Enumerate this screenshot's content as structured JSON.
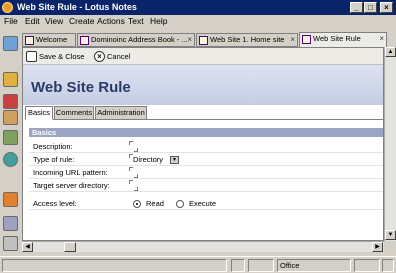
{
  "window": {
    "title": "Web Site Rule - Lotus Notes",
    "minimize": "_",
    "maximize": "□",
    "close": "×"
  },
  "menu": [
    "File",
    "Edit",
    "View",
    "Create",
    "Actions",
    "Text",
    "Help"
  ],
  "tabs": [
    {
      "label": "Welcome"
    },
    {
      "label": "Dominoinc Address Book - ..."
    },
    {
      "label": "Web Site 1. Home site"
    },
    {
      "label": "Web Site Rule"
    }
  ],
  "tab_close": "×",
  "actions": {
    "save_close": "Save & Close",
    "cancel": "Cancel"
  },
  "form": {
    "title": "Web Site Rule",
    "subtabs": [
      "Basics",
      "Comments",
      "Administration"
    ],
    "section": "Basics",
    "fields": {
      "description": "Description:",
      "type": "Type of rule:",
      "type_value": "Directory",
      "incoming": "Incoming URL pattern:",
      "target": "Target server directory:",
      "access": "Access level:"
    },
    "access_options": [
      "Read",
      "Execute"
    ],
    "access_selected": "Read"
  },
  "status": {
    "location": "Office"
  }
}
